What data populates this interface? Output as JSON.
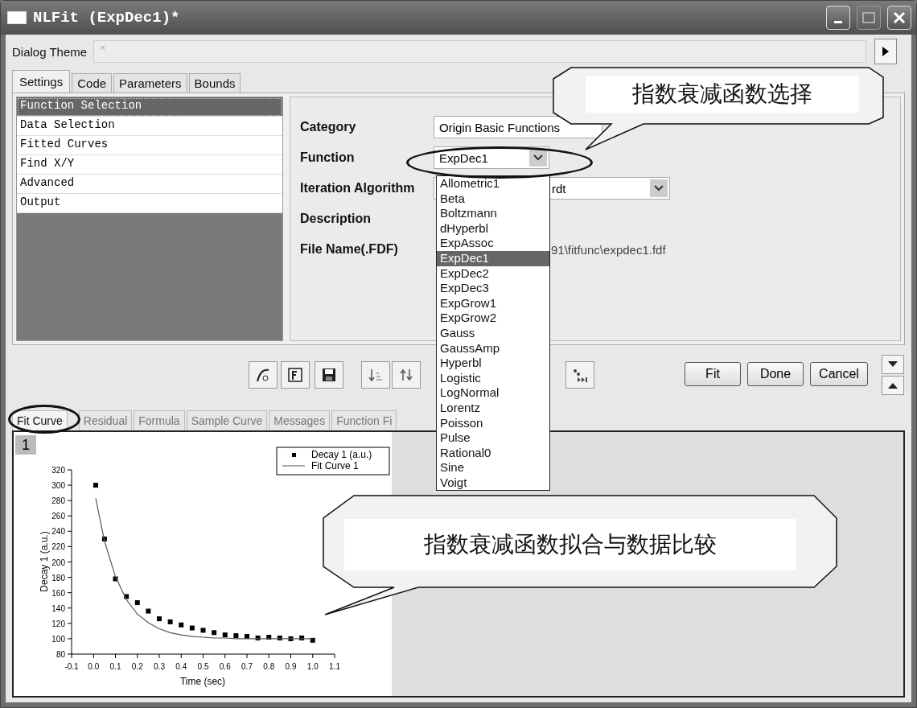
{
  "window": {
    "title": "NLFit (ExpDec1)*"
  },
  "dialog_theme": {
    "label": "Dialog Theme",
    "placeholder": "×"
  },
  "tabs": [
    {
      "label": "Settings",
      "selected": true
    },
    {
      "label": "Code",
      "selected": false
    },
    {
      "label": "Parameters",
      "selected": false
    },
    {
      "label": "Bounds",
      "selected": false
    }
  ],
  "sidebar": {
    "items": [
      {
        "label": "Function Selection",
        "selected": true
      },
      {
        "label": "Data Selection",
        "selected": false
      },
      {
        "label": "Fitted Curves",
        "selected": false
      },
      {
        "label": "Find X/Y",
        "selected": false
      },
      {
        "label": "Advanced",
        "selected": false
      },
      {
        "label": "Output",
        "selected": false
      }
    ]
  },
  "settings": {
    "fields": [
      {
        "label": "Category",
        "kind": "combo",
        "value": "Origin Basic Functions"
      },
      {
        "label": "Function",
        "kind": "combo",
        "value": "ExpDec1"
      },
      {
        "label": "Iteration Algorithm",
        "kind": "combo",
        "value": "rdt"
      },
      {
        "label": "Description",
        "kind": "text"
      },
      {
        "label": "File Name(.FDF)",
        "kind": "text",
        "value": "91\\fitfunc\\expdec1.fdf"
      }
    ]
  },
  "function_dropdown": {
    "options": [
      {
        "label": "Allometric1",
        "selected": false
      },
      {
        "label": "Beta",
        "selected": false
      },
      {
        "label": "Boltzmann",
        "selected": false
      },
      {
        "label": "dHyperbl",
        "selected": false
      },
      {
        "label": "ExpAssoc",
        "selected": false
      },
      {
        "label": "ExpDec1",
        "selected": true
      },
      {
        "label": "ExpDec2",
        "selected": false
      },
      {
        "label": "ExpDec3",
        "selected": false
      },
      {
        "label": "ExpGrow1",
        "selected": false
      },
      {
        "label": "ExpGrow2",
        "selected": false
      },
      {
        "label": "Gauss",
        "selected": false
      },
      {
        "label": "GaussAmp",
        "selected": false
      },
      {
        "label": "Hyperbl",
        "selected": false
      },
      {
        "label": "Logistic",
        "selected": false
      },
      {
        "label": "LogNormal",
        "selected": false
      },
      {
        "label": "Lorentz",
        "selected": false
      },
      {
        "label": "Poisson",
        "selected": false
      },
      {
        "label": "Pulse",
        "selected": false
      },
      {
        "label": "Rational0",
        "selected": false
      },
      {
        "label": "Sine",
        "selected": false
      },
      {
        "label": "Voigt",
        "selected": false
      }
    ]
  },
  "buttons": [
    {
      "label": "Fit"
    },
    {
      "label": "Done"
    },
    {
      "label": "Cancel"
    }
  ],
  "result_tabs": [
    {
      "label": "Fit Curve",
      "selected": true
    },
    {
      "label": "Residual",
      "selected": false
    },
    {
      "label": "Formula",
      "selected": false
    },
    {
      "label": "Sample Curve",
      "selected": false
    },
    {
      "label": "Messages",
      "selected": false
    },
    {
      "label": "Function Fi",
      "selected": false
    }
  ],
  "graph": {
    "panel_number": "1",
    "chart_data": {
      "type": "scatter",
      "xlabel": "Time (sec)",
      "ylabel": "Decay 1 (a.u.)",
      "x": [
        0.01,
        0.05,
        0.1,
        0.15,
        0.2,
        0.25,
        0.3,
        0.35,
        0.4,
        0.45,
        0.5,
        0.55,
        0.6,
        0.65,
        0.7,
        0.75,
        0.8,
        0.85,
        0.9,
        0.95,
        1.0
      ],
      "series": [
        {
          "name": "Decay 1 (a.u.)",
          "type": "scatter",
          "color": "#000000",
          "values": [
            300,
            230,
            178,
            155,
            147,
            136,
            126,
            122,
            118,
            114,
            111,
            108,
            105,
            104,
            103,
            101,
            102,
            101,
            100,
            101,
            98
          ]
        },
        {
          "name": "Fit Curve 1",
          "type": "line",
          "color": "#555555",
          "values": [
            283,
            227,
            181,
            151,
            132,
            121,
            113,
            108,
            105,
            103,
            102,
            101,
            101,
            100,
            100,
            100,
            100,
            100,
            100,
            100,
            100
          ]
        }
      ],
      "legend": true,
      "xlim": [
        -0.1,
        1.1
      ],
      "ylim": [
        80,
        320
      ],
      "xticks": [
        {
          "value": -0.1,
          "label": "-0.1"
        },
        {
          "value": 0,
          "label": "0.0"
        },
        {
          "value": 0.1,
          "label": "0.1"
        },
        {
          "value": 0.2,
          "label": "0.2"
        },
        {
          "value": 0.3,
          "label": "0.3"
        },
        {
          "value": 0.4,
          "label": "0.4"
        },
        {
          "value": 0.5,
          "label": "0.5"
        },
        {
          "value": 0.6,
          "label": "0.6"
        },
        {
          "value": 0.7,
          "label": "0.7"
        },
        {
          "value": 0.8,
          "label": "0.8"
        },
        {
          "value": 0.9,
          "label": "0.9"
        },
        {
          "value": 1.0,
          "label": "1.0"
        },
        {
          "value": 1.1,
          "label": "1.1"
        }
      ],
      "yticks": [
        80,
        100,
        120,
        140,
        160,
        180,
        200,
        220,
        240,
        260,
        280,
        300,
        320
      ]
    }
  },
  "callouts": [
    {
      "text": "指数衰减函数选择"
    },
    {
      "text": "指数衰减函数拟合与数据比较"
    }
  ]
}
